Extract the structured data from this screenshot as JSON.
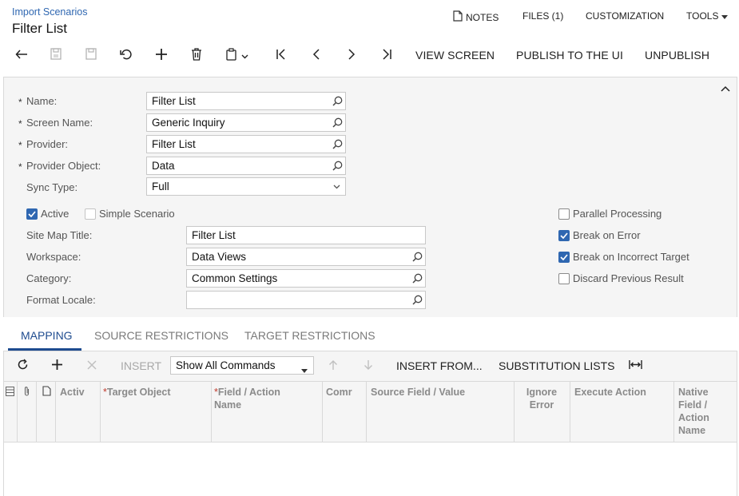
{
  "header": {
    "breadcrumb": "Import Scenarios",
    "title": "Filter List",
    "nav": {
      "notes": "NOTES",
      "files": "FILES (1)",
      "customization": "CUSTOMIZATION",
      "tools": "TOOLS"
    }
  },
  "toolbar": {
    "icons": [
      "back-icon",
      "save-close-icon",
      "save-icon",
      "undo-icon",
      "add-icon",
      "delete-icon",
      "copy-paste-icon",
      "first-record-icon",
      "previous-record-icon",
      "next-record-icon",
      "last-record-icon"
    ],
    "view_screen": "VIEW SCREEN",
    "publish": "PUBLISH TO THE UI",
    "unpublish": "UNPUBLISH"
  },
  "form": {
    "name": {
      "label": "Name:",
      "value": "Filter List"
    },
    "screen_name": {
      "label": "Screen Name:",
      "value": "Generic Inquiry"
    },
    "provider": {
      "label": "Provider:",
      "value": "Filter List"
    },
    "provider_object": {
      "label": "Provider Object:",
      "value": "Data"
    },
    "sync_type": {
      "label": "Sync Type:",
      "value": "Full"
    },
    "active": {
      "label": "Active",
      "checked": true
    },
    "simple_scenario": {
      "label": "Simple Scenario",
      "checked": false
    },
    "site_map_title": {
      "label": "Site Map Title:",
      "value": "Filter List"
    },
    "workspace": {
      "label": "Workspace:",
      "value": "Data Views"
    },
    "category": {
      "label": "Category:",
      "value": "Common Settings"
    },
    "format_locale": {
      "label": "Format Locale:",
      "value": ""
    },
    "parallel_processing": {
      "label": "Parallel Processing",
      "checked": false
    },
    "break_on_error": {
      "label": "Break on Error",
      "checked": true
    },
    "break_on_incorrect_target": {
      "label": "Break on Incorrect Target",
      "checked": true
    },
    "discard_previous_result": {
      "label": "Discard Previous Result",
      "checked": false
    },
    "required_mark": "*"
  },
  "tabs": [
    {
      "label": "MAPPING",
      "active": true
    },
    {
      "label": "SOURCE RESTRICTIONS",
      "active": false
    },
    {
      "label": "TARGET RESTRICTIONS",
      "active": false
    }
  ],
  "grid_toolbar": {
    "insert": "INSERT",
    "commands_filter": "Show All Commands",
    "insert_from": "INSERT FROM...",
    "substitution_lists": "SUBSTITUTION LISTS"
  },
  "grid": {
    "columns": [
      "Activ",
      "Target Object",
      "Field / Action Name",
      "Comr",
      "Source Field / Value",
      "Ignore Error",
      "Execute Action",
      "Native Field / Action Name"
    ],
    "rows": []
  },
  "colors": {
    "accent": "#2f67b1",
    "tab_active": "#1e4b8f",
    "required": "#c0392b"
  }
}
